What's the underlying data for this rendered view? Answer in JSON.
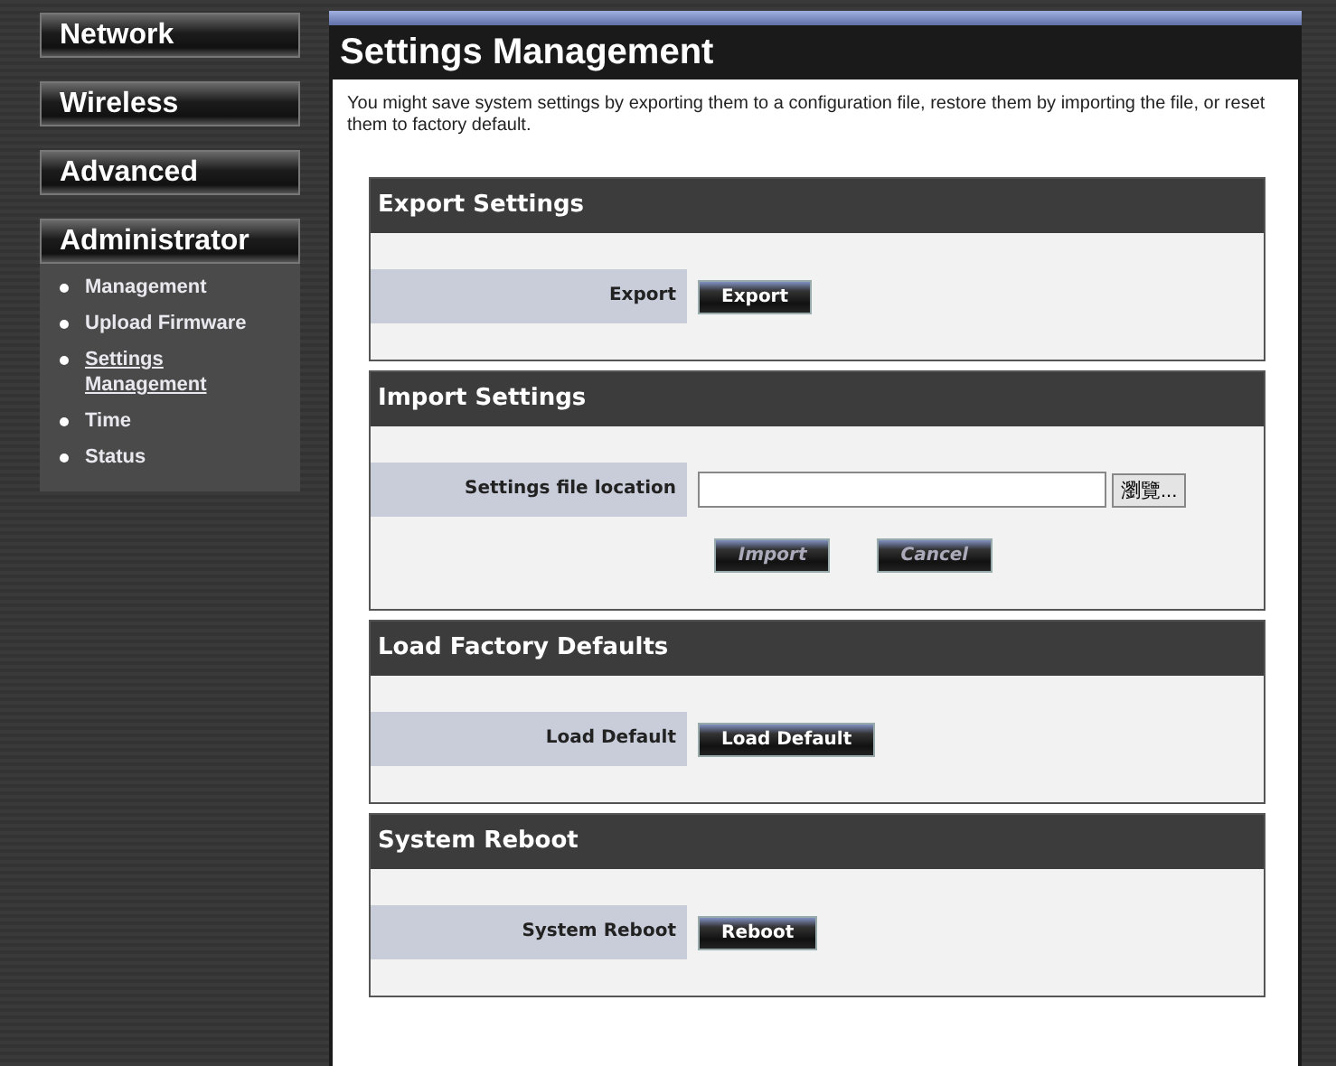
{
  "sidebar": {
    "menus": [
      {
        "label": "Network"
      },
      {
        "label": "Wireless"
      },
      {
        "label": "Advanced"
      },
      {
        "label": "Administrator",
        "items": [
          {
            "label": "Management",
            "selected": false
          },
          {
            "label": "Upload Firmware",
            "selected": false
          },
          {
            "label": "Settings Management",
            "selected": true
          },
          {
            "label": "Time",
            "selected": false
          },
          {
            "label": "Status",
            "selected": false
          }
        ]
      }
    ]
  },
  "page": {
    "title": "Settings Management",
    "description": "You might save system settings by exporting them to a configuration file, restore them by importing the file, or reset them to factory default.",
    "sections": [
      {
        "kind": "row",
        "title": "Export Settings",
        "label": "Export",
        "button": "Export"
      },
      {
        "kind": "file",
        "title": "Import Settings",
        "label": "Settings file location",
        "browse": "瀏覽...",
        "buttons": [
          "Import",
          "Cancel"
        ]
      },
      {
        "kind": "row",
        "title": "Load Factory Defaults",
        "label": "Load Default",
        "button": "Load Default"
      },
      {
        "kind": "row",
        "title": "System Reboot",
        "label": "System Reboot",
        "button": "Reboot"
      }
    ]
  }
}
